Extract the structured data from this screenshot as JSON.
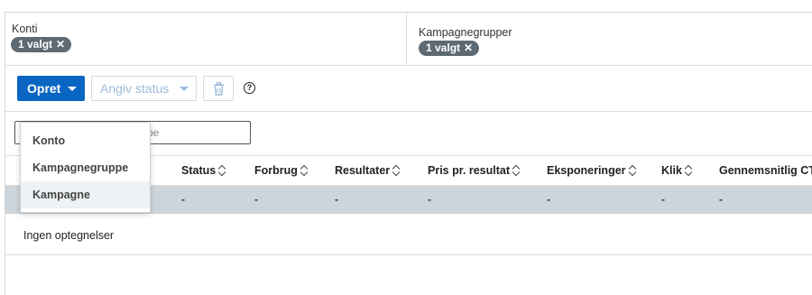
{
  "filters": {
    "accounts": {
      "label": "Konti",
      "chip": "1 valgt"
    },
    "campaign_groups": {
      "label": "Kampagnegrupper",
      "chip": "1 valgt"
    },
    "chip_remove_icon": "close-icon"
  },
  "toolbar": {
    "create_label": "Opret",
    "set_status_label": "Angiv status",
    "delete_icon": "trash-icon",
    "help_icon": "help-icon",
    "help_glyph": "?"
  },
  "search": {
    "placeholder": "ype"
  },
  "table": {
    "columns": [
      "Status",
      "Forbrug",
      "Resultater",
      "Pris pr. resultat",
      "Eksponeringer",
      "Klik",
      "Gennemsnitlig CT"
    ],
    "summary_row": [
      "-",
      "-",
      "-",
      "-",
      "-",
      "-",
      "-"
    ],
    "empty_text": "Ingen optegnelser"
  },
  "create_menu": {
    "items": [
      "Konto",
      "Kampagnegruppe",
      "Kampagne"
    ],
    "highlighted": "Kampagne"
  },
  "colors": {
    "primary": "#0a66c2",
    "chip": "#5d6a73",
    "summary_row": "#cdd5dc"
  }
}
